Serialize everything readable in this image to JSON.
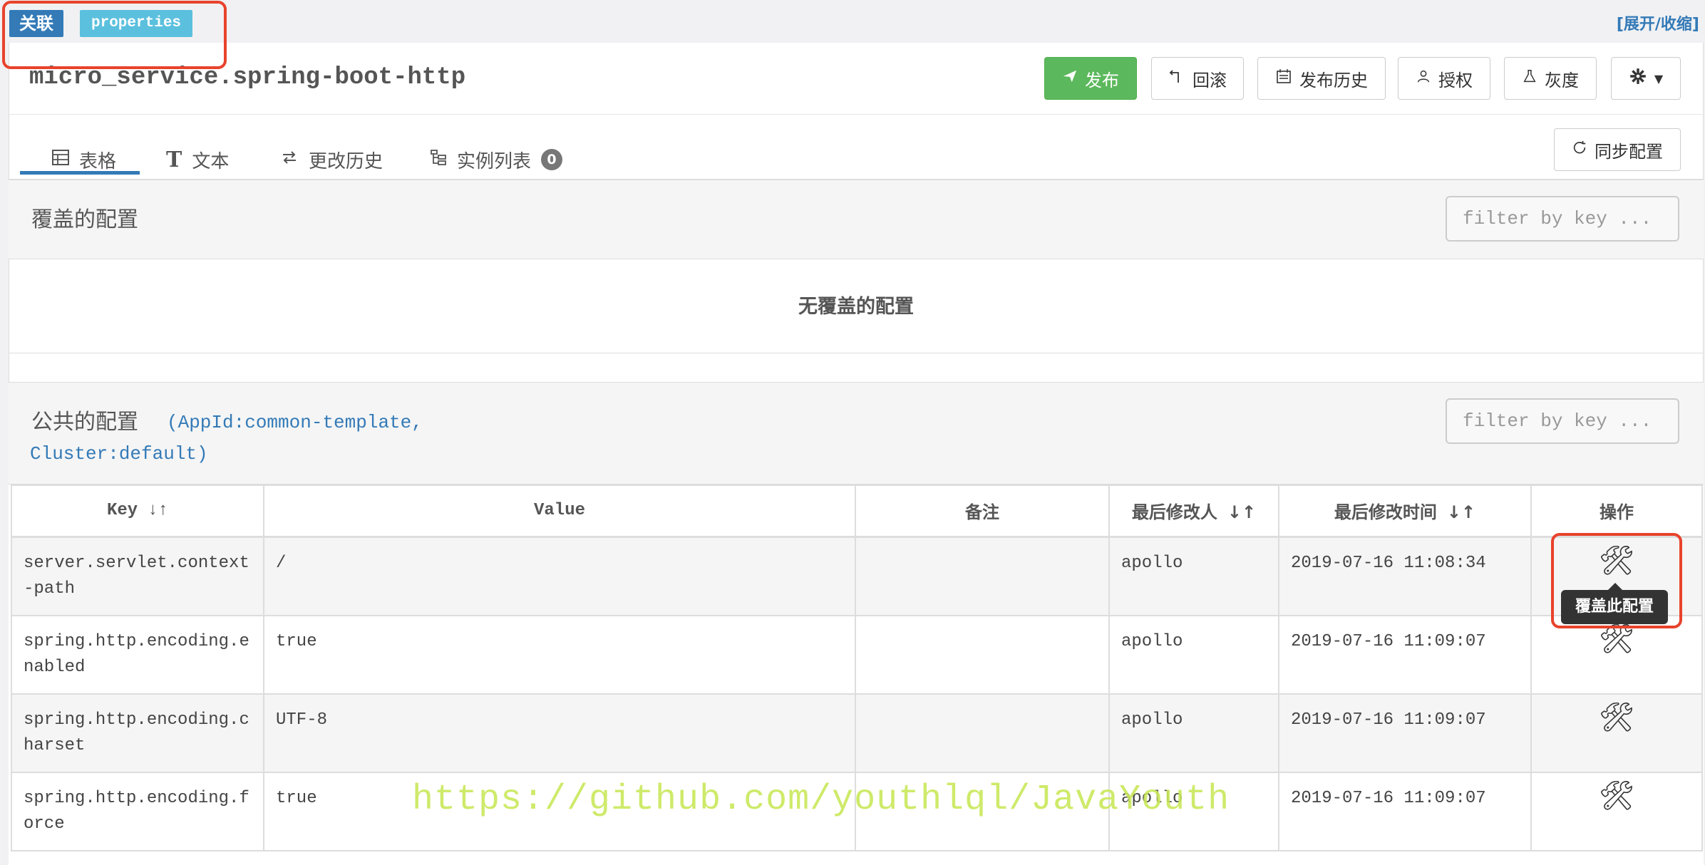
{
  "top": {
    "assoc_badge": "关联",
    "format_badge": "properties",
    "toggle_link": "[展开/收缩]"
  },
  "namespace": {
    "title": "micro_service.spring-boot-http"
  },
  "toolbar": {
    "publish": "发布",
    "rollback": "回滚",
    "history": "发布历史",
    "grant": "授权",
    "gray": "灰度",
    "settings_icon": "gear-icon"
  },
  "tabs": [
    {
      "label": "表格",
      "icon": "table-icon"
    },
    {
      "label": "文本",
      "icon": "text-icon"
    },
    {
      "label": "更改历史",
      "icon": "swap-icon"
    },
    {
      "label": "实例列表",
      "icon": "tree-icon",
      "count": "0"
    }
  ],
  "sync_button": "同步配置",
  "override_panel": {
    "title": "覆盖的配置",
    "filter_placeholder": "filter by key ...",
    "empty_message": "无覆盖的配置"
  },
  "public_panel": {
    "title": "公共的配置",
    "app_id_line": "(AppId:common-template,",
    "cluster_line": "Cluster:default)",
    "filter_placeholder": "filter by key ..."
  },
  "table": {
    "headers": [
      "Key",
      "Value",
      "备注",
      "最后修改人",
      "最后修改时间",
      "操作"
    ],
    "rows": [
      {
        "key": "server.servlet.context-path",
        "value": "/",
        "comment": "",
        "modifier": "apollo",
        "time": "2019-07-16 11:08:34"
      },
      {
        "key": "spring.http.encoding.enabled",
        "value": "true",
        "comment": "",
        "modifier": "apollo",
        "time": "2019-07-16 11:09:07"
      },
      {
        "key": "spring.http.encoding.charset",
        "value": "UTF-8",
        "comment": "",
        "modifier": "apollo",
        "time": "2019-07-16 11:09:07"
      },
      {
        "key": "spring.http.encoding.force",
        "value": "true",
        "comment": "",
        "modifier": "apollo",
        "time": "2019-07-16 11:09:07"
      }
    ]
  },
  "tooltip": "覆盖此配置",
  "watermark": "https://github.com/youthlql/JavaYouth",
  "colors": {
    "primary": "#337ab7",
    "success": "#5cb85c",
    "info": "#5bc0de",
    "highlight": "#e8432c"
  }
}
